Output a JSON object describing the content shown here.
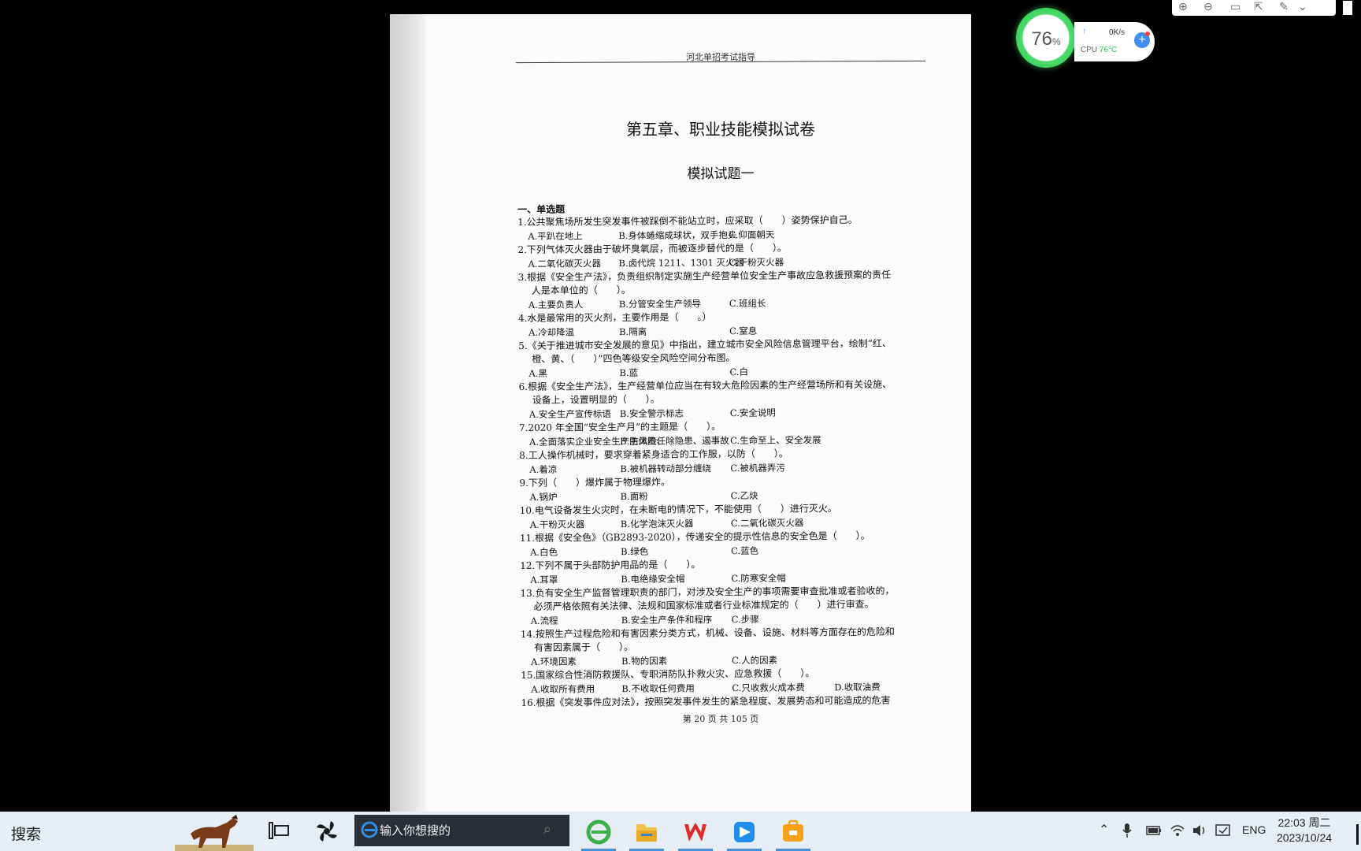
{
  "document": {
    "header": "河北单招考试指导",
    "title": "第五章、职业技能模拟试卷",
    "subtitle": "模拟试题一",
    "section": "一、单选题",
    "questions": [
      {
        "stem": [
          "1.公共聚焦场所发生突发事件被踩倒不能站立时，应采取（　　）姿势保护自己。"
        ],
        "options": [
          "A.平趴在地上",
          "B.身体蜷缩成球状，双手抱头",
          "C.仰面朝天"
        ]
      },
      {
        "stem": [
          "2.下列气体灭火器由于破坏臭氧层，而被逐步替代的是（　　）。"
        ],
        "options": [
          "A.二氧化碳灭火器",
          "B.卤代烷 1211、1301 灭火器",
          "C.干粉灭火器"
        ]
      },
      {
        "stem": [
          "3.根据《安全生产法》，负责组织制定实施生产经营单位安全生产事故应急救援预案的责任",
          "人是本单位的（　　）。"
        ],
        "options": [
          "A.主要负责人",
          "B.分管安全生产领导",
          "C.班组长"
        ]
      },
      {
        "stem": [
          "4.水是最常用的灭火剂，主要作用是（　　。）"
        ],
        "options": [
          "A.冷却降温",
          "B.隔离",
          "C.窒息"
        ]
      },
      {
        "stem": [
          "5.《关于推进城市安全发展的意见》中指出，建立城市安全风险信息管理平台，绘制“红、",
          "橙、黄、（　　）”四色等级安全风险空间分布图。"
        ],
        "options": [
          "A.黑",
          "B.蓝",
          "C.白"
        ]
      },
      {
        "stem": [
          "6.根据《安全生产法》，生产经营单位应当在有较大危险因素的生产经营场所和有关设施、",
          "设备上，设置明显的（　　）。"
        ],
        "options": [
          "A.安全生产宣传标语",
          "B.安全警示标志",
          "C.安全说明"
        ]
      },
      {
        "stem": [
          "7.2020 年全国“安全生产月”的主题是（　　）。"
        ],
        "options": [
          "A.全面落实企业安全生产主体责任",
          "B.防风险、除隐患、遏事故",
          "C.生命至上、安全发展"
        ]
      },
      {
        "stem": [
          "8.工人操作机械时，要求穿着紧身适合的工作服，以防（　　）。"
        ],
        "options": [
          "A.着凉",
          "B.被机器转动部分缠绕",
          "C.被机器弄污"
        ]
      },
      {
        "stem": [
          "9.下列（　　）爆炸属于物理爆炸。"
        ],
        "options": [
          "A.锅炉",
          "B.面粉",
          "C.乙炔"
        ]
      },
      {
        "stem": [
          "10.电气设备发生火灾时，在未断电的情况下，不能使用（　　）进行灭火。"
        ],
        "options": [
          "A.干粉灭火器",
          "B.化学泡沫灭火器",
          "C.二氧化碳灭火器"
        ]
      },
      {
        "stem": [
          "11.根据《安全色》（GB2893-2020），传递安全的提示性信息的安全色是（　　）。"
        ],
        "options": [
          "A.白色",
          "B.绿色",
          "C.蓝色"
        ]
      },
      {
        "stem": [
          "12.下列不属于头部防护用品的是（　　）。"
        ],
        "options": [
          "A.耳罩",
          "B.电绝缘安全帽",
          "C.防寒安全帽"
        ]
      },
      {
        "stem": [
          "13.负有安全生产监督管理职责的部门，对涉及安全生产的事项需要审查批准或者验收的，",
          "必须严格依照有关法律、法规和国家标准或者行业标准规定的（　　）进行审查。"
        ],
        "options": [
          "A.流程",
          "B.安全生产条件和程序",
          "C.步骤"
        ]
      },
      {
        "stem": [
          "14.按照生产过程危险和有害因素分类方式，机械、设备、设施、材料等方面存在的危险和",
          "有害因素属于（　　）。"
        ],
        "options": [
          "A.环境因素",
          "B.物的因素",
          "C.人的因素"
        ]
      },
      {
        "stem": [
          "15.国家综合性消防救援队、专职消防队扑救火灾、应急救援（　　）。"
        ],
        "options": [
          "A.收取所有费用",
          "B.不收取任何费用",
          "C.只收救火成本费",
          "D.收取油费"
        ]
      },
      {
        "stem": [
          "16.根据《突发事件应对法》，按照突发事件发生的紧急程度、发展势态和可能造成的危害"
        ],
        "options": []
      }
    ],
    "footer": "第 20 页 共 105 页"
  },
  "widget": {
    "cpu_usage": "76",
    "cpu_usage_unit": "%",
    "net_speed": "0K/s",
    "cpu_label": "CPU",
    "cpu_temp": "76°C",
    "accent": "#3ed35e"
  },
  "taskbar": {
    "search_label": "搜索",
    "search_placeholder": "输入你想搜的",
    "language": "ENG",
    "time": "22:03 周二",
    "date": "2023/10/24"
  }
}
